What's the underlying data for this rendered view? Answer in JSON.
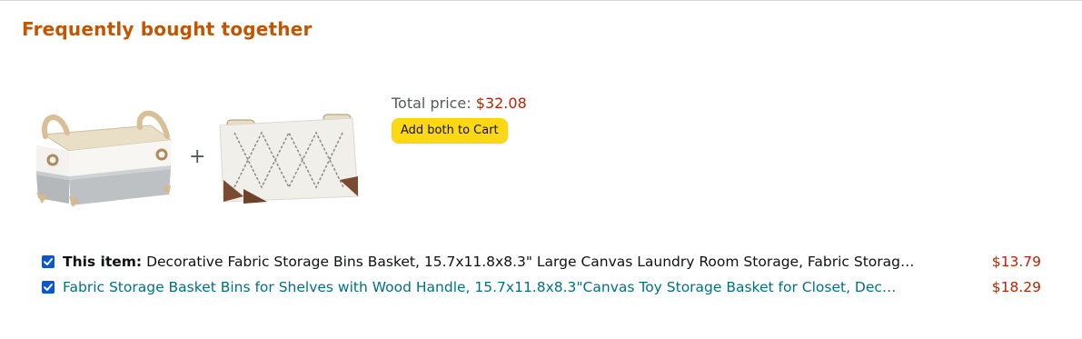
{
  "title": "Frequently bought together",
  "plus_sign": "+",
  "total_label": "Total price:",
  "total_price": "$32.08",
  "add_button_label": "Add both to Cart",
  "items": [
    {
      "prefix": "This item:",
      "name": "Decorative Fabric Storage Bins Basket, 15.7x11.8x8.3\" Large Canvas Laundry Room Storage, Fabric Storag…",
      "price": "$13.79",
      "checked": true
    },
    {
      "prefix": "",
      "name": "Fabric Storage Basket Bins for Shelves with Wood Handle, 15.7x11.8x8.3\"Canvas Toy Storage Basket for Closet, Dec…",
      "price": "$18.29",
      "checked": true
    }
  ],
  "colors": {
    "title": "#c45500",
    "price": "#b12704",
    "link": "#007185",
    "button": "#ffd814",
    "checkbox": "#0b57d0"
  }
}
